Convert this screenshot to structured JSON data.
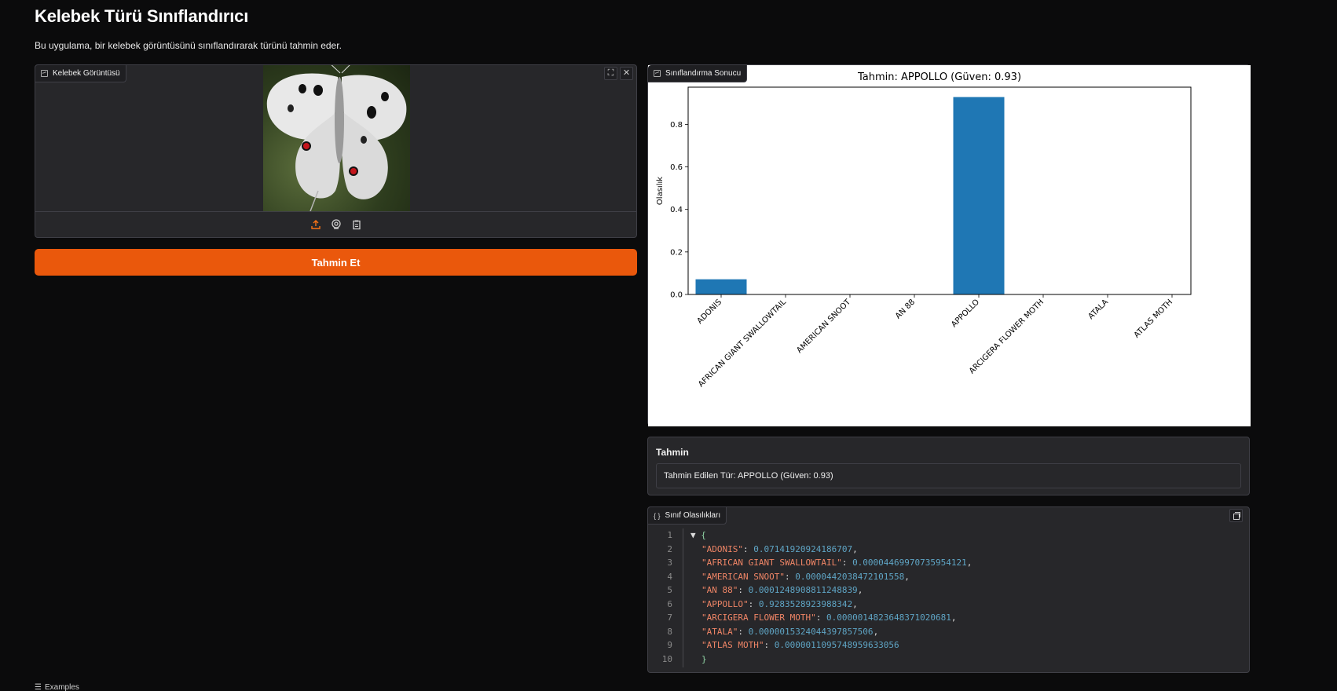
{
  "app": {
    "title": "Kelebek Türü Sınıflandırıcı",
    "description": "Bu uygulama, bir kelebek görüntüsünü sınıflandırarak türünü tahmin eder."
  },
  "image_input": {
    "label": "Kelebek Görüntüsü",
    "label_icon": "image-icon",
    "tools": [
      "fullscreen-icon",
      "close-icon"
    ],
    "sources": [
      "upload-icon",
      "webcam-icon",
      "clipboard-icon"
    ]
  },
  "submit": {
    "label": "Tahmin Et"
  },
  "plot": {
    "label": "Sınıflandırma Sonucu",
    "label_icon": "chart-icon"
  },
  "chart_data": {
    "type": "bar",
    "title": "Tahmin: APPOLLO (Güven: 0.93)",
    "xlabel": "",
    "ylabel": "Olasılık",
    "categories": [
      "ADONIS",
      "AFRICAN GIANT SWALLOWTAIL",
      "AMERICAN SNOOT",
      "AN 88",
      "APPOLLO",
      "ARCIGERA FLOWER MOTH",
      "ATALA",
      "ATLAS MOTH"
    ],
    "values": [
      0.0714,
      4e-05,
      4e-05,
      0.00012,
      0.9284,
      1e-06,
      2e-06,
      1e-06
    ],
    "yticks": [
      "0.0",
      "0.2",
      "0.4",
      "0.6",
      "0.8"
    ],
    "ytick_values": [
      0,
      0.2,
      0.4,
      0.6,
      0.8
    ],
    "ylim": [
      0,
      0.975
    ],
    "bar_color": "#1f77b4",
    "grid": false
  },
  "prediction": {
    "label": "Tahmin",
    "value": "Tahmin Edilen Tür: APPOLLO (Güven: 0.93)"
  },
  "json_output": {
    "label": "Sınıf Olasılıkları",
    "line_numbers": [
      "1",
      "2",
      "3",
      "4",
      "5",
      "6",
      "7",
      "8",
      "9",
      "10"
    ],
    "open_brace": "{",
    "close_brace": "}",
    "entries": [
      {
        "key": "\"ADONIS\"",
        "value": "0.07141920924186707",
        "sep": ","
      },
      {
        "key": "\"AFRICAN GIANT SWALLOWTAIL\"",
        "value": "0.00004469970735954121",
        "sep": ","
      },
      {
        "key": "\"AMERICAN SNOOT\"",
        "value": "0.0000442038472101558",
        "sep": ","
      },
      {
        "key": "\"AN 88\"",
        "value": "0.0001248908811248839",
        "sep": ","
      },
      {
        "key": "\"APPOLLO\"",
        "value": "0.9283528923988342",
        "sep": ","
      },
      {
        "key": "\"ARCIGERA FLOWER MOTH\"",
        "value": "0.0000014823648371020681",
        "sep": ","
      },
      {
        "key": "\"ATALA\"",
        "value": "0.0000015324044397857506",
        "sep": ","
      },
      {
        "key": "\"ATLAS MOTH\"",
        "value": "0.0000011095748959633056",
        "sep": ""
      }
    ]
  },
  "examples": {
    "label": "Examples"
  },
  "colors": {
    "accent": "#ea580c",
    "background": "#0b0b0c",
    "panel": "#27272a"
  }
}
